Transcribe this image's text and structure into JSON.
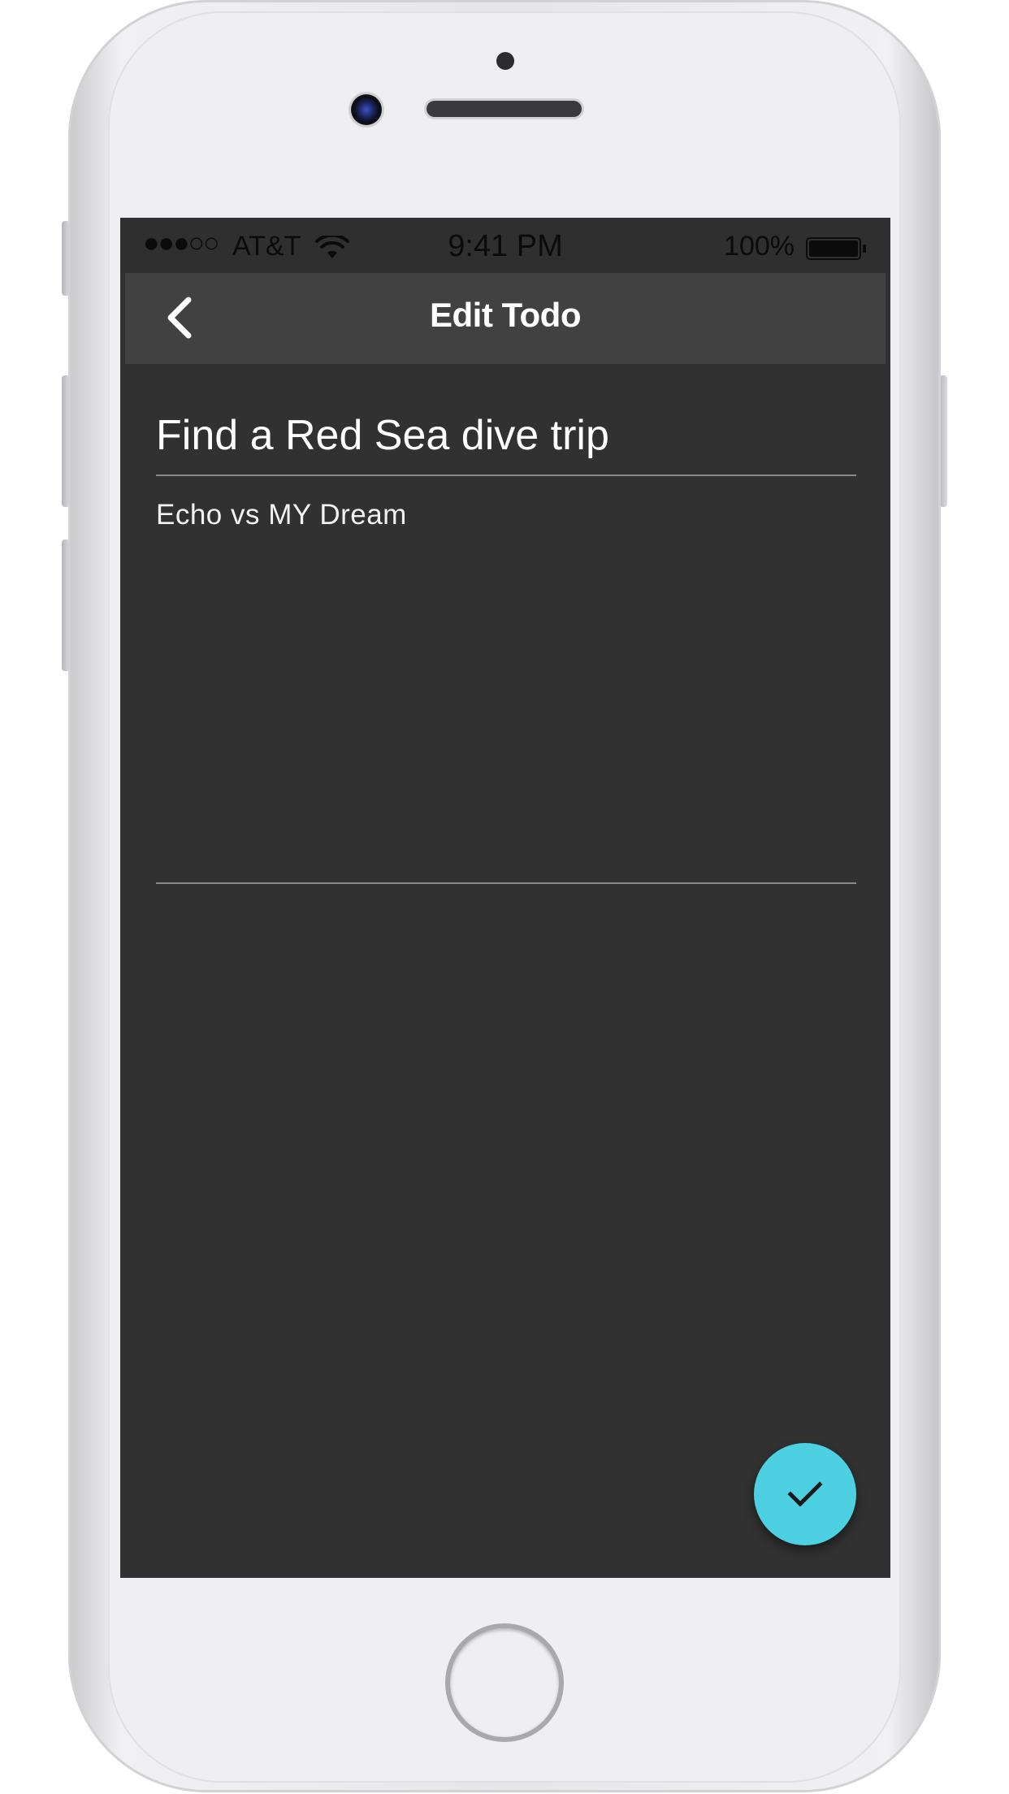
{
  "status_bar": {
    "signal": "●●●○○",
    "carrier": "AT&T",
    "time": "9:41 PM",
    "battery_percent": "100%",
    "battery_level": 1.0
  },
  "nav": {
    "title": "Edit Todo",
    "back_icon": "chevron-left-icon"
  },
  "form": {
    "title_value": "Find a Red Sea dive trip",
    "notes_value": "Echo vs MY Dream"
  },
  "fab": {
    "icon": "check-icon",
    "color": "#4dd0e1"
  },
  "colors": {
    "screen_bg": "#313131",
    "nav_bg": "#414141",
    "text": "#ffffff",
    "divider": "#8a8a8a"
  }
}
